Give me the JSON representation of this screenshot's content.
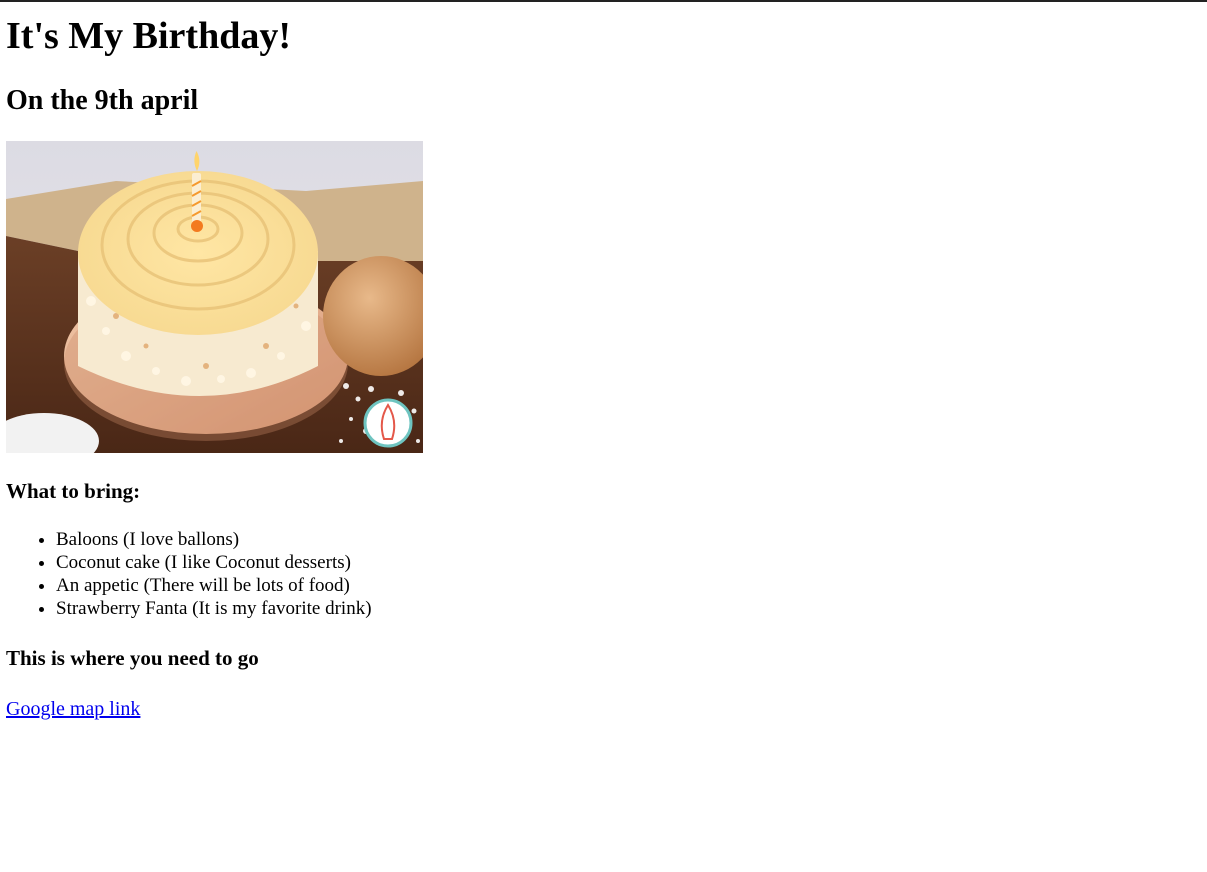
{
  "page": {
    "title": "It's My Birthday!",
    "date_heading": "On the 9th april"
  },
  "photo": {
    "alt": "Coconut birthday cake with a lit candle"
  },
  "bring": {
    "heading": "What to bring:",
    "items": [
      "Baloons (I love ballons)",
      "Coconut cake (I like Coconut desserts)",
      "An appetic (There will be lots of food)",
      "Strawberry Fanta (It is my favorite drink)"
    ]
  },
  "directions": {
    "heading": "This is where you need to go",
    "link_label": "Google map link"
  }
}
